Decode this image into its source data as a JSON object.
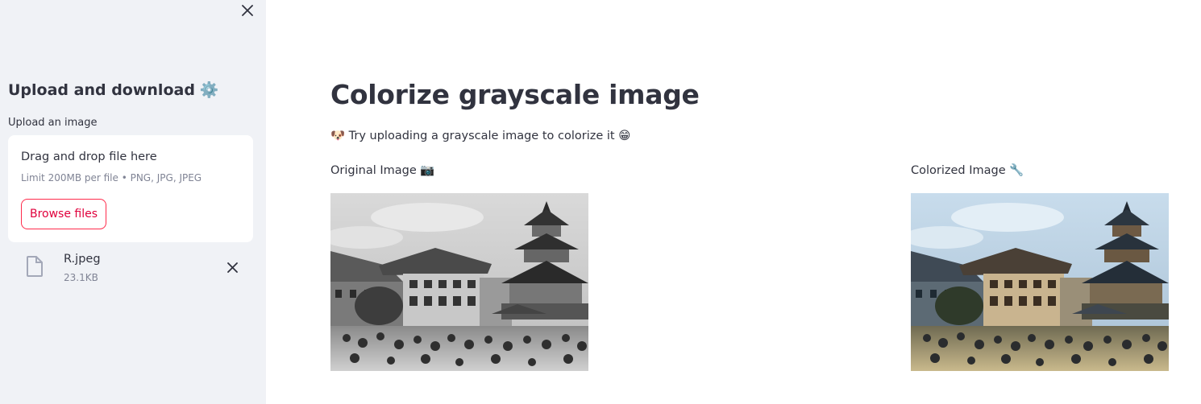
{
  "sidebar": {
    "header": "Upload and download",
    "header_emoji": "⚙️",
    "upload_label": "Upload an image",
    "dropzone": {
      "title": "Drag and drop file here",
      "limit": "Limit 200MB per file • PNG, JPG, JPEG",
      "browse_label": "Browse files"
    },
    "file": {
      "name": "R.jpeg",
      "size": "23.1KB"
    }
  },
  "main": {
    "title": "Colorize grayscale image",
    "intro": "🐶 Try uploading a grayscale image to colorize it 😁",
    "original_caption": "Original Image 📷",
    "colorized_caption": "Colorized Image 🔧"
  },
  "colors": {
    "accent": "#ff2b4b",
    "sidebar_bg": "#f0f2f6",
    "text": "#31333f",
    "muted": "#808495"
  },
  "icons": {
    "sidebar_close": "close-icon",
    "file": "file-icon",
    "file_remove": "close-icon"
  }
}
